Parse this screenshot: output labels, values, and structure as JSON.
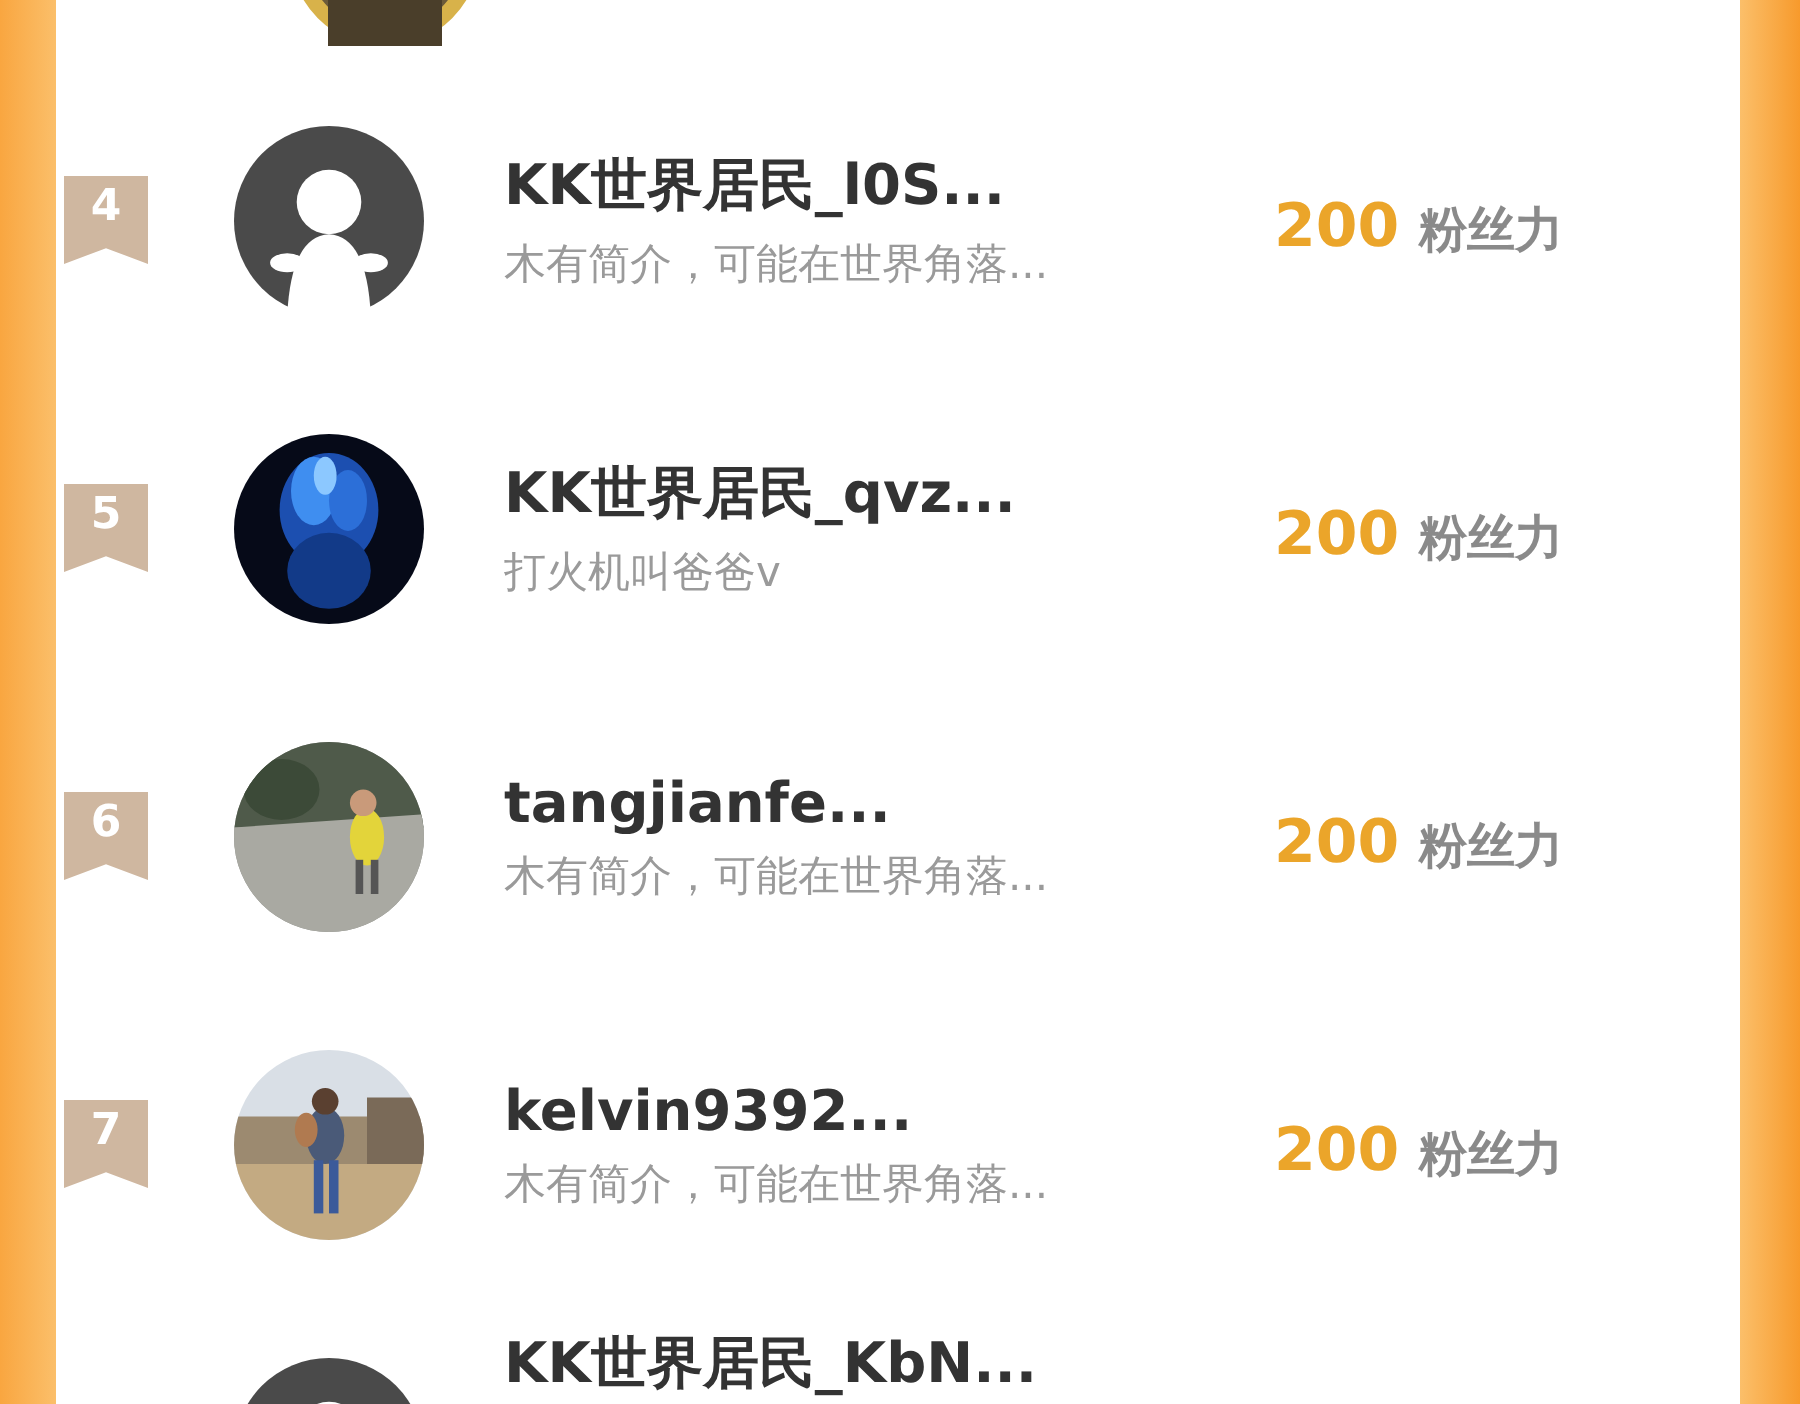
{
  "rows": [
    {
      "rank": "4",
      "name": "KK世界居民_l0S...",
      "bio": "木有简介，可能在世界角落...",
      "score": "200",
      "score_label": "粉丝力",
      "kind": "default"
    },
    {
      "rank": "5",
      "name": "KK世界居民_qvz...",
      "bio": "打火机叫爸爸v",
      "score": "200",
      "score_label": "粉丝力",
      "kind": "picture"
    },
    {
      "rank": "6",
      "name": "tangjianfe...",
      "bio": "木有简介，可能在世界角落...",
      "score": "200",
      "score_label": "粉丝力",
      "kind": "picture"
    },
    {
      "rank": "7",
      "name": "kelvin9392...",
      "bio": "木有简介，可能在世界角落...",
      "score": "200",
      "score_label": "粉丝力",
      "kind": "picture"
    },
    {
      "name": "KK世界居民_KbN...",
      "kind": "default"
    }
  ]
}
